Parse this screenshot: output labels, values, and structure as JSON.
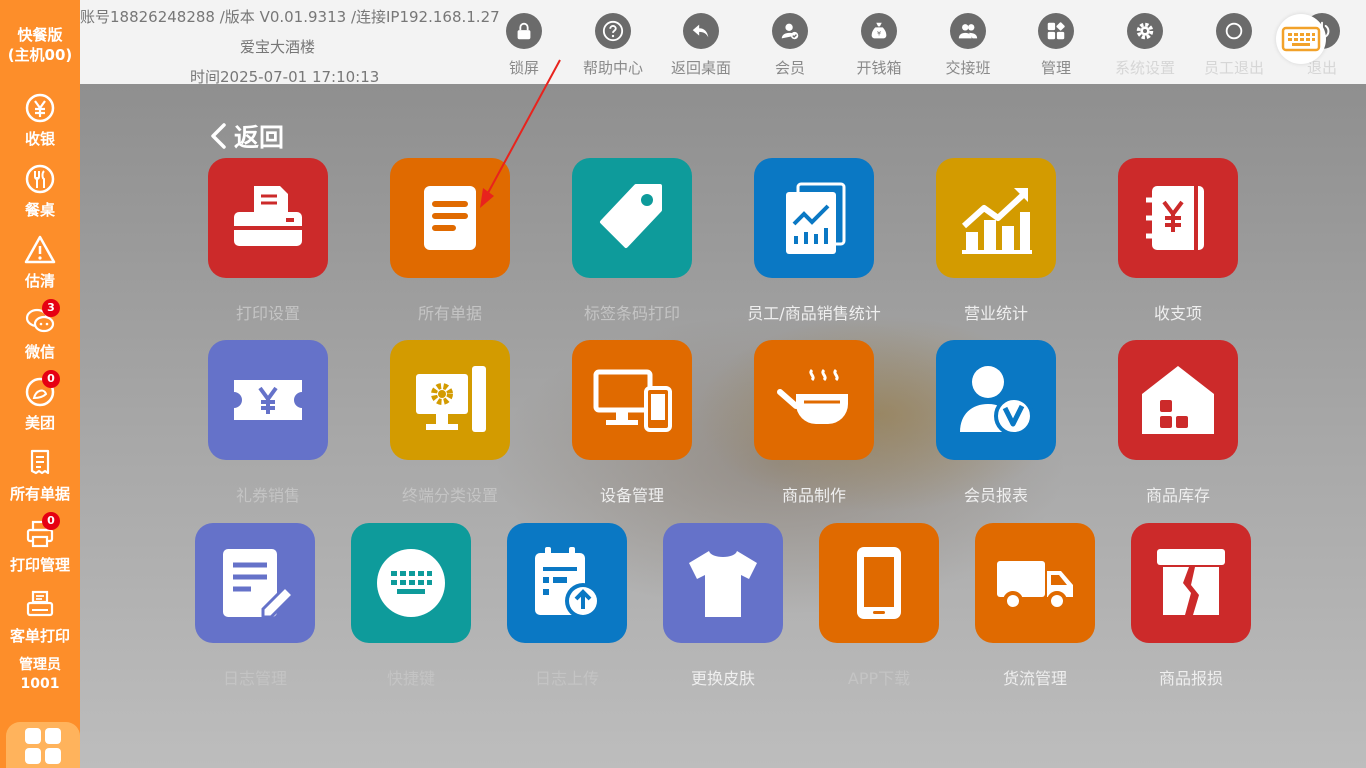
{
  "sidebar": {
    "brand_line1": "快餐版",
    "brand_line2": "(主机00)",
    "items": [
      {
        "label": "收银",
        "icon": "yen-coin-icon"
      },
      {
        "label": "餐桌",
        "icon": "fork-knife-icon"
      },
      {
        "label": "估清",
        "icon": "warning-icon"
      },
      {
        "label": "微信",
        "icon": "wechat-icon",
        "badge": "3"
      },
      {
        "label": "美团",
        "icon": "meituan-icon",
        "badge": "0"
      },
      {
        "label": "所有单据",
        "icon": "receipt-icon"
      },
      {
        "label": "打印管理",
        "icon": "printer-icon",
        "badge": "0"
      },
      {
        "label": "客单打印",
        "icon": "ticket-printer-icon"
      }
    ],
    "admin_role": "管理员",
    "admin_id": "1001"
  },
  "header": {
    "account_line": "账号18826248288 /版本 V0.01.9313 /连接IP192.168.1.27",
    "store_name": "爱宝大酒楼",
    "time_line": "时间2025-07-01 17:10:13",
    "toolbar": [
      {
        "label": "锁屏",
        "icon": "lock-icon"
      },
      {
        "label": "帮助中心",
        "icon": "help-icon"
      },
      {
        "label": "返回桌面",
        "icon": "back-arrow-icon"
      },
      {
        "label": "会员",
        "icon": "member-icon"
      },
      {
        "label": "开钱箱",
        "icon": "money-bag-icon"
      },
      {
        "label": "交接班",
        "icon": "shift-handover-icon"
      },
      {
        "label": "管理",
        "icon": "grid-manage-icon"
      },
      {
        "label": "系统设置",
        "icon": "gear-icon"
      },
      {
        "label": "员工退出",
        "icon": "logout-icon"
      },
      {
        "label": "退出",
        "icon": "power-icon"
      }
    ]
  },
  "back_label": "返回",
  "tiles": [
    {
      "label": "打印设置",
      "icon": "printer-icon",
      "color": "#cc2a2a"
    },
    {
      "label": "所有单据",
      "icon": "document-list-icon",
      "color": "#e06a00"
    },
    {
      "label": "标签条码打印",
      "icon": "tag-icon",
      "color": "#0e9b9b"
    },
    {
      "label": "员工/商品销售统计",
      "icon": "sales-report-icon",
      "color": "#0a78c4"
    },
    {
      "label": "营业统计",
      "icon": "business-chart-icon",
      "color": "#d39b00"
    },
    {
      "label": "收支项",
      "icon": "ledger-yen-icon",
      "color": "#cc2a2a"
    },
    {
      "label": "礼券销售",
      "icon": "coupon-icon",
      "color": "#6572c9"
    },
    {
      "label": "终端分类设置",
      "icon": "terminal-settings-icon",
      "color": "#d39b00"
    },
    {
      "label": "设备管理",
      "icon": "devices-icon",
      "color": "#e06a00"
    },
    {
      "label": "商品制作",
      "icon": "cooking-pot-icon",
      "color": "#e06a00"
    },
    {
      "label": "会员报表",
      "icon": "vip-member-icon",
      "color": "#0a78c4"
    },
    {
      "label": "商品库存",
      "icon": "warehouse-icon",
      "color": "#cc2a2a"
    },
    {
      "label": "日志管理",
      "icon": "log-edit-icon",
      "color": "#6572c9"
    },
    {
      "label": "快捷键",
      "icon": "keyboard-icon",
      "color": "#0e9b9b"
    },
    {
      "label": "日志上传",
      "icon": "log-upload-icon",
      "color": "#0a78c4"
    },
    {
      "label": "更换皮肤",
      "icon": "tshirt-icon",
      "color": "#6572c9"
    },
    {
      "label": "APP下载",
      "icon": "phone-icon",
      "color": "#e06a00"
    },
    {
      "label": "货流管理",
      "icon": "truck-icon",
      "color": "#e06a00"
    },
    {
      "label": "商品报损",
      "icon": "broken-box-icon",
      "color": "#cc2a2a"
    }
  ]
}
